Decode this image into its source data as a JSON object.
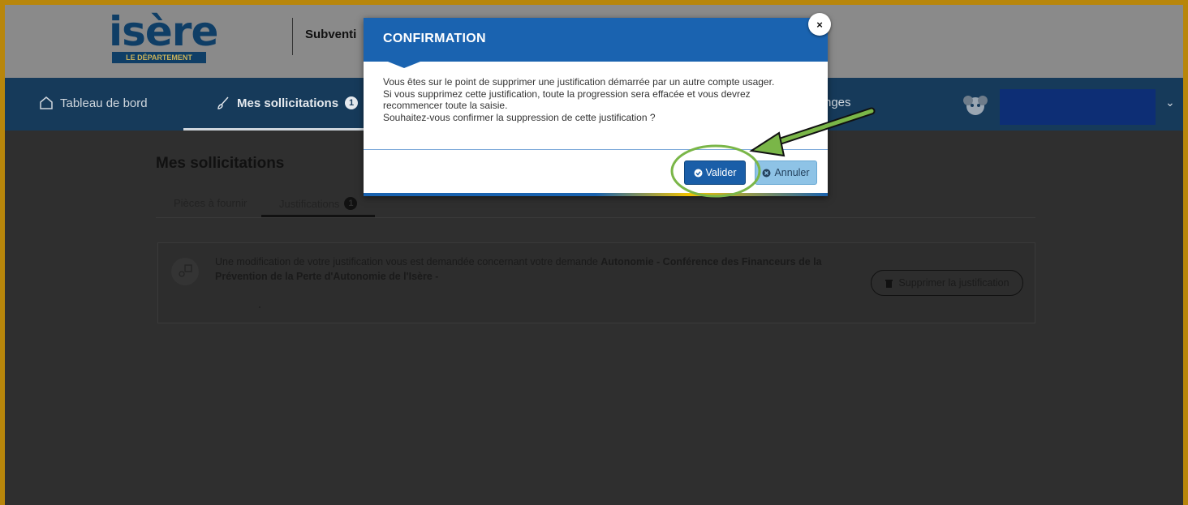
{
  "logo": {
    "name": "isère",
    "tagline": "LE DÉPARTEMENT"
  },
  "topbar": {
    "title": "Subventi"
  },
  "nav": {
    "home_label": "Tableau de bord",
    "sollicitations_label": "Mes sollicitations",
    "sollicitations_badge": "1",
    "partial_label": "nges"
  },
  "page": {
    "title": "Mes sollicitations",
    "tabs": [
      {
        "label": "Pièces à fournir"
      },
      {
        "label": "Justifications",
        "badge": "1"
      }
    ]
  },
  "card": {
    "text_start": "Une modification de votre justification vous est demandée concernant votre demande ",
    "text_bold": "Autonomie - Conférence des Financeurs de la Prévention de la Perte d'Autonomie de l'Isère -",
    "delete_label": "Supprimer la justification"
  },
  "modal": {
    "title": "CONFIRMATION",
    "body_lines": [
      "Vous êtes sur le point de supprimer une justification démarrée par un autre compte usager.",
      "Si vous supprimez cette justification, toute la progression sera effacée et vous devrez",
      "recommencer toute la saisie.",
      "Souhaitez-vous confirmer la suppression de cette justification ?"
    ],
    "confirm_label": "Valider",
    "cancel_label": "Annuler",
    "close_label": "×"
  },
  "colors": {
    "modal_header": "#1a63b0",
    "confirm_button": "#1a5ea8",
    "cancel_button": "#8ec3e6",
    "annotation_green": "#7ab648",
    "frame_border": "#b8860b"
  }
}
